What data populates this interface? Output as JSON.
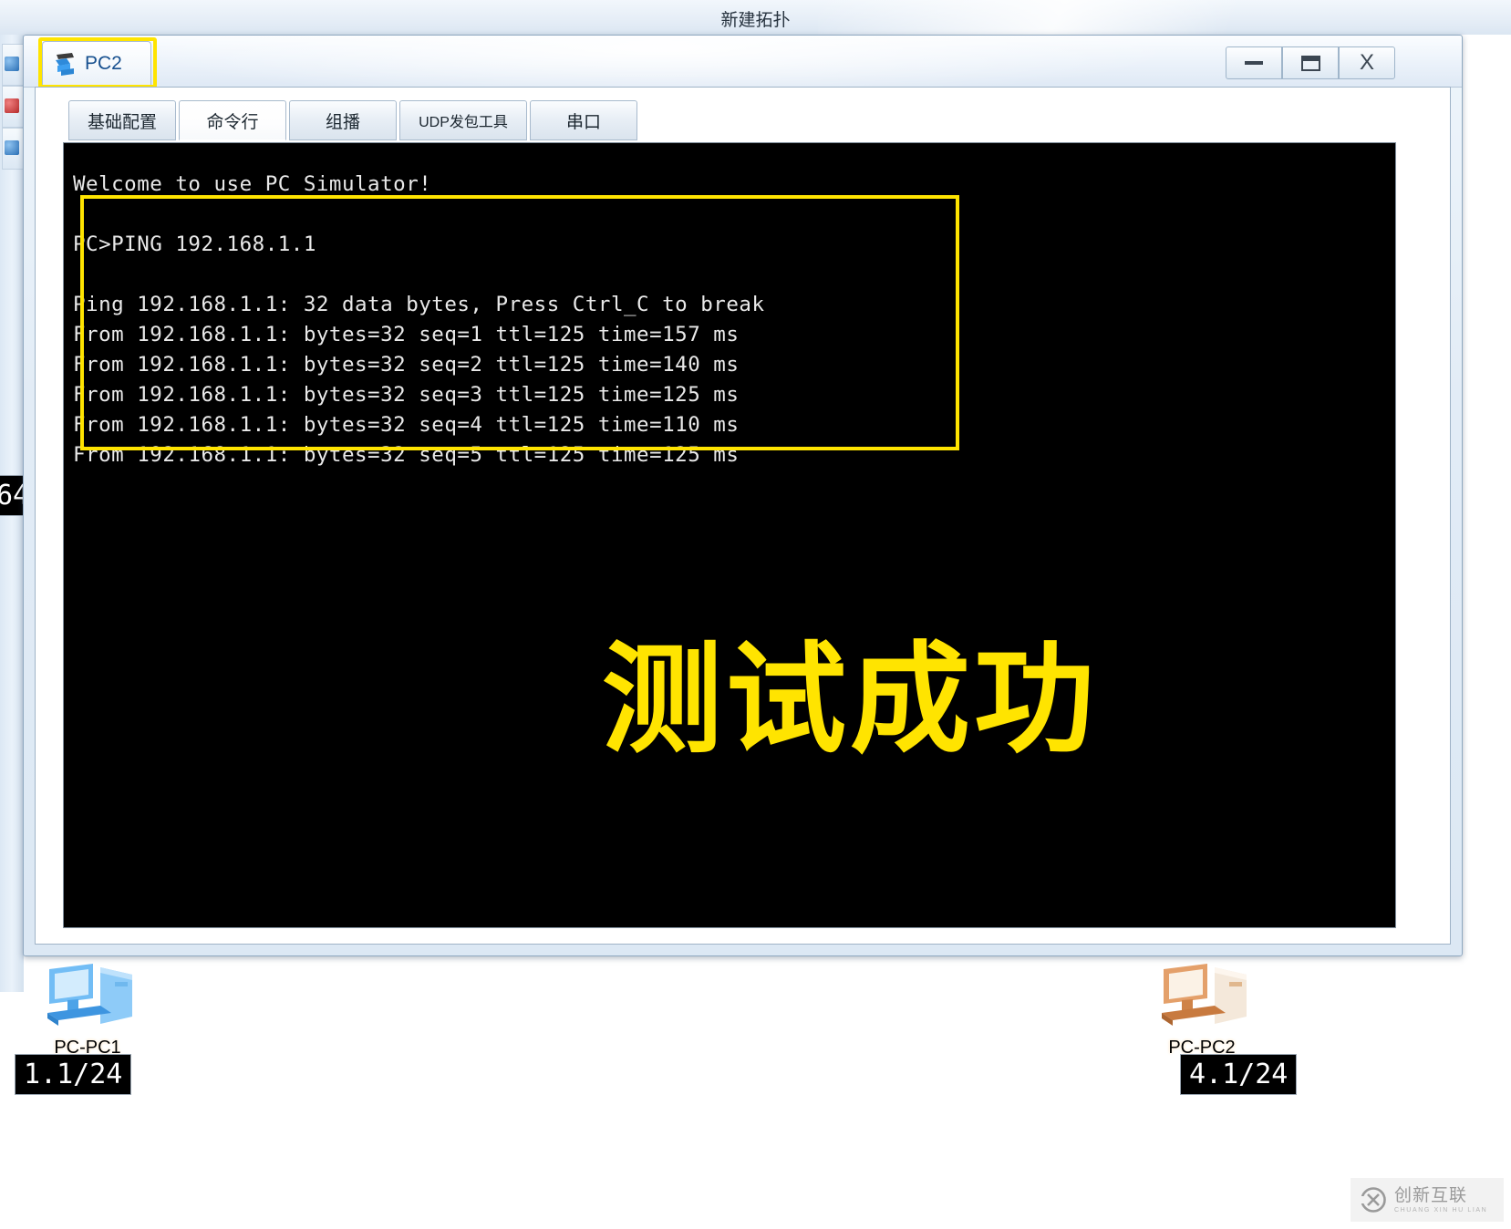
{
  "app": {
    "title": "新建拓扑"
  },
  "window": {
    "tab_label": "PC2",
    "tab_icon": "pc-device-icon",
    "controls": {
      "minimize": "–",
      "maximize": "□",
      "close": "X"
    }
  },
  "config_tabs": [
    {
      "label": "基础配置",
      "selected": false
    },
    {
      "label": "命令行",
      "selected": true
    },
    {
      "label": "组播",
      "selected": false
    },
    {
      "label": "UDP发包工具",
      "selected": false
    },
    {
      "label": "串口",
      "selected": false
    }
  ],
  "terminal": {
    "welcome": "Welcome to use PC Simulator!",
    "blank1": "",
    "prompt_line": "PC>PING 192.168.1.1",
    "blank2": "",
    "ping_header": "Ping 192.168.1.1: 32 data bytes, Press Ctrl_C to break",
    "replies": [
      "From 192.168.1.1: bytes=32 seq=1 ttl=125 time=157 ms",
      "From 192.168.1.1: bytes=32 seq=2 ttl=125 time=140 ms",
      "From 192.168.1.1: bytes=32 seq=3 ttl=125 time=125 ms",
      "From 192.168.1.1: bytes=32 seq=4 ttl=125 time=110 ms",
      "From 192.168.1.1: bytes=32 seq=5 ttl=125 time=125 ms"
    ],
    "full_text": "Welcome to use PC Simulator!\n\nPC>PING 192.168.1.1\n\nPing 192.168.1.1: 32 data bytes, Press Ctrl_C to break\nFrom 192.168.1.1: bytes=32 seq=1 ttl=125 time=157 ms\nFrom 192.168.1.1: bytes=32 seq=2 ttl=125 time=140 ms\nFrom 192.168.1.1: bytes=32 seq=3 ttl=125 time=125 ms\nFrom 192.168.1.1: bytes=32 seq=4 ttl=125 time=110 ms\nFrom 192.168.1.1: bytes=32 seq=5 ttl=125 time=125 ms",
    "annotation_banner": "测试成功",
    "highlight_color": "#ffe400",
    "banner_color": "#ffe400",
    "background_color": "#000000",
    "text_color": "#e9e9e9"
  },
  "topology": {
    "nodes": [
      {
        "name": "PC-PC1",
        "icon": "pc-workstation-icon",
        "color": "#5fb0f0"
      },
      {
        "name": "PC-PC2",
        "icon": "pc-workstation-icon",
        "color": "#e09a62"
      }
    ],
    "ip_tags": [
      {
        "value": "1.1/24"
      },
      {
        "value": "4.1/24"
      },
      {
        "value": "64"
      }
    ]
  },
  "watermark": {
    "cn": "创新互联",
    "en": "CHUANG XIN HU LIAN",
    "logo": "cx-logo-icon"
  }
}
